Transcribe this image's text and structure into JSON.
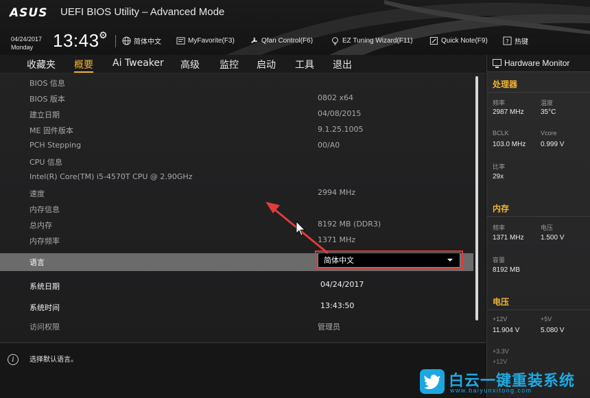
{
  "header": {
    "logo": "ASUS",
    "title": "UEFI BIOS Utility – Advanced Mode",
    "date": "04/24/2017",
    "weekday": "Monday",
    "time": "13:43",
    "buttons": {
      "language": "简体中文",
      "favorite": "MyFavorite(F3)",
      "qfan": "Qfan Control(F6)",
      "ez_tuning": "EZ Tuning Wizard(F11)",
      "quick_note": "Quick Note(F9)",
      "hotkeys": "热键"
    }
  },
  "tabs": [
    "收藏夹",
    "概要",
    "Ai Tweaker",
    "高级",
    "监控",
    "启动",
    "工具",
    "退出"
  ],
  "active_tab": "概要",
  "rows": [
    {
      "label": "BIOS 信息",
      "value": ""
    },
    {
      "label": "BIOS 版本",
      "value": "0802 x64"
    },
    {
      "label": "建立日期",
      "value": "04/08/2015"
    },
    {
      "label": "ME 固件版本",
      "value": "9.1.25.1005"
    },
    {
      "label": "PCH Stepping",
      "value": "00/A0"
    },
    {
      "label": "CPU 信息",
      "value": ""
    },
    {
      "label": "Intel(R) Core(TM) i5-4570T CPU @ 2.90GHz",
      "value": ""
    },
    {
      "label": "速度",
      "value": "2994 MHz"
    },
    {
      "label": "内存信息",
      "value": ""
    },
    {
      "label": "总内存",
      "value": "8192 MB (DDR3)"
    },
    {
      "label": "内存频率",
      "value": "1371 MHz"
    }
  ],
  "settings": {
    "language": {
      "label": "语言",
      "value": "简体中文"
    },
    "system_date": {
      "label": "系统日期",
      "value": "04/24/2017"
    },
    "system_time": {
      "label": "系统时间",
      "value": "13:43:50"
    },
    "access_level": {
      "label": "访问权限",
      "value": "管理员"
    }
  },
  "info_bar": {
    "text": "选择默认语言。"
  },
  "hardware_monitor": {
    "title": "Hardware Monitor",
    "cpu": {
      "heading": "处理器",
      "freq_label": "频率",
      "freq_value": "2987 MHz",
      "temp_label": "温度",
      "temp_value": "35°C",
      "bclk_label": "BCLK",
      "bclk_value": "103.0 MHz",
      "vcore_label": "Vcore",
      "vcore_value": "0.999 V",
      "ratio_label": "比率",
      "ratio_value": "29x"
    },
    "memory": {
      "heading": "内存",
      "freq_label": "频率",
      "freq_value": "1371 MHz",
      "volt_label": "电压",
      "volt_value": "1.500 V",
      "cap_label": "容量",
      "cap_value": "8192 MB"
    },
    "voltage": {
      "heading": "电压",
      "v12_label": "+12V",
      "v12_value": "11.904 V",
      "v5_label": "+5V",
      "v5_value": "5.080 V",
      "v33_label": "+3.3V",
      "v12b_label": "+12V"
    }
  },
  "watermark": {
    "name": "白云一键重装系统",
    "url": "www.baiyunxitong.com"
  },
  "colors": {
    "accent": "#f0b432",
    "highlight": "#e23b3b",
    "watermark": "#1ea9e1"
  }
}
